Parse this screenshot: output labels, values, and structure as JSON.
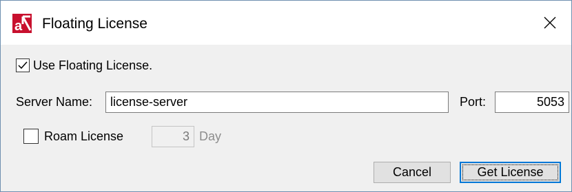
{
  "window": {
    "title": "Floating License",
    "app_icon": "app-logo-icon",
    "close_icon": "close-icon"
  },
  "floating": {
    "checkbox_label": "Use Floating License.",
    "checked": true
  },
  "server": {
    "label": "Server Name:",
    "value": "license-server"
  },
  "port": {
    "label": "Port:",
    "value": "5053"
  },
  "roam": {
    "checkbox_label": "Roam License",
    "checked": false,
    "days_value": "3",
    "days_unit": "Day"
  },
  "buttons": {
    "cancel": "Cancel",
    "get_license": "Get License"
  },
  "colors": {
    "accent": "#0078d7",
    "icon_red": "#c8102e"
  }
}
